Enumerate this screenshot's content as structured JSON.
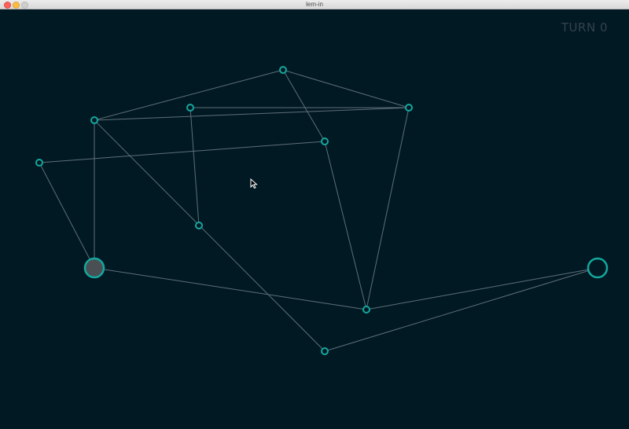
{
  "window": {
    "title": "lem-in"
  },
  "hud": {
    "turn_label": "TURN",
    "turn_value": "0"
  },
  "graph": {
    "rooms": [
      {
        "id": "r1",
        "type": "room"
      },
      {
        "id": "r2",
        "type": "room"
      },
      {
        "id": "r3",
        "type": "room"
      },
      {
        "id": "r4",
        "type": "room"
      },
      {
        "id": "r5",
        "type": "room"
      },
      {
        "id": "r6",
        "type": "room"
      },
      {
        "id": "r7",
        "type": "room"
      },
      {
        "id": "start",
        "type": "start"
      },
      {
        "id": "end",
        "type": "end"
      },
      {
        "id": "r8",
        "type": "room"
      },
      {
        "id": "r9",
        "type": "room"
      }
    ],
    "links": [
      [
        "r1",
        "r3"
      ],
      [
        "r1",
        "r4"
      ],
      [
        "r1",
        "r6"
      ],
      [
        "r2",
        "r4"
      ],
      [
        "r2",
        "r7"
      ],
      [
        "r3",
        "r4"
      ],
      [
        "r3",
        "start"
      ],
      [
        "r3",
        "r9"
      ],
      [
        "r5",
        "r6"
      ],
      [
        "r5",
        "start"
      ],
      [
        "r4",
        "r8"
      ],
      [
        "r6",
        "r8"
      ],
      [
        "start",
        "r8"
      ],
      [
        "r8",
        "end"
      ],
      [
        "r9",
        "end"
      ]
    ],
    "colors": {
      "background": "#011923",
      "link": "#5f6f78",
      "node_stroke": "#14a89f",
      "node_fill": "#011923",
      "start_fill": "#4a4f53",
      "turn_text": "#34414b"
    }
  }
}
